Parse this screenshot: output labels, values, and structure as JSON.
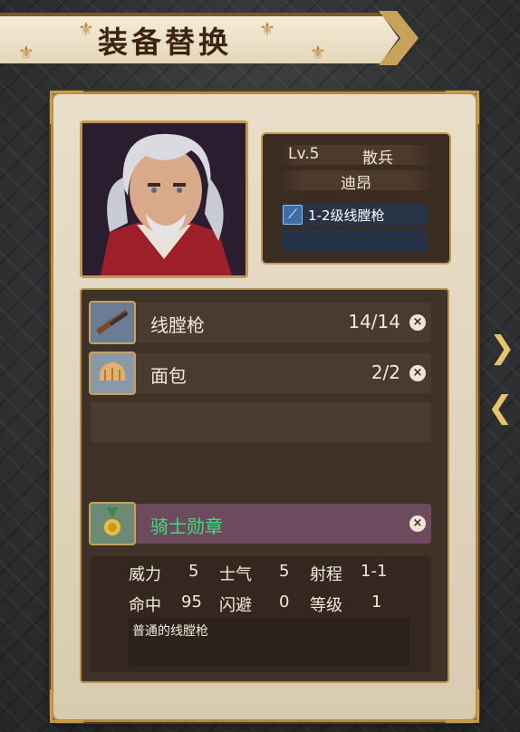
{
  "title": "装备替换",
  "character": {
    "level": "Lv.5",
    "class": "散兵",
    "name": "迪昂",
    "weapon_label": "1-2级线膛枪"
  },
  "items": [
    {
      "name": "线膛枪",
      "count": "14/14",
      "icon": "rifle-icon"
    },
    {
      "name": "面包",
      "count": "2/2",
      "icon": "bread-icon"
    }
  ],
  "accessory": {
    "name": "骑士勋章",
    "icon": "medal-icon"
  },
  "stats": {
    "power_label": "威力",
    "power": "5",
    "morale_label": "士气",
    "morale": "5",
    "range_label": "射程",
    "range": "1-1",
    "hit_label": "命中",
    "hit": "95",
    "evade_label": "闪避",
    "evade": "0",
    "rank_label": "等级",
    "rank": "1",
    "description": "普通的线膛枪"
  },
  "colors": {
    "accent_gold": "#c29a54",
    "accessory_green": "#39e07a",
    "accessory_row": "#6e4a5e"
  }
}
